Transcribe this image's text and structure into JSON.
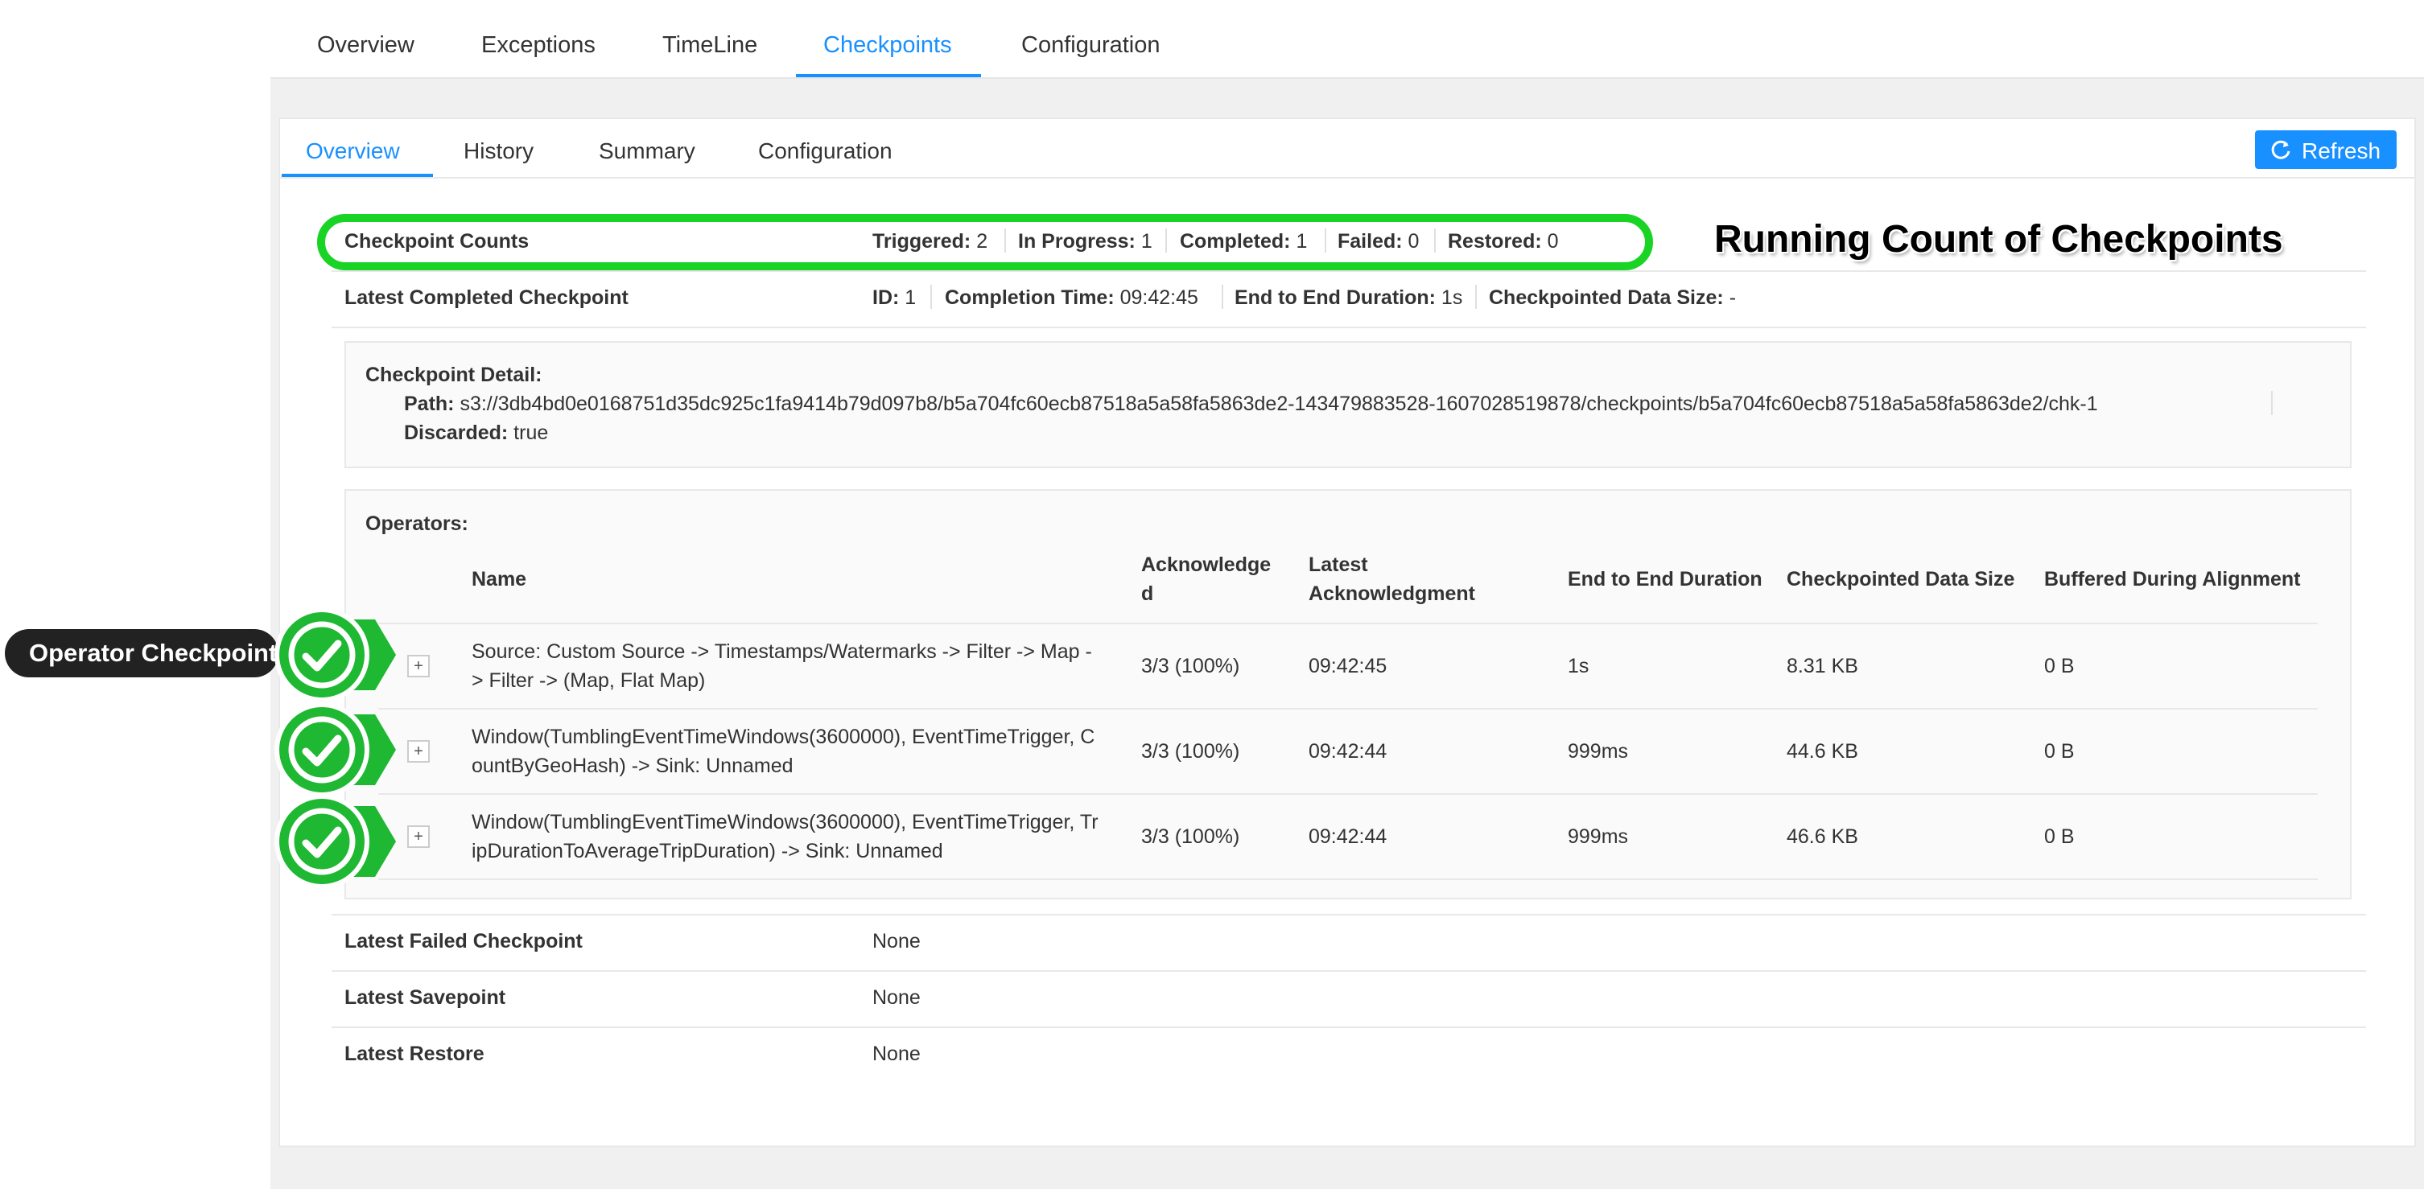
{
  "top_tabs": {
    "overview": "Overview",
    "exceptions": "Exceptions",
    "timeline": "TimeLine",
    "checkpoints": "Checkpoints",
    "configuration": "Configuration",
    "active": "Checkpoints"
  },
  "sub_tabs": {
    "overview": "Overview",
    "history": "History",
    "summary": "Summary",
    "configuration": "Configuration",
    "active": "Overview"
  },
  "refresh": {
    "label": "Refresh",
    "icon": "sync-icon"
  },
  "checkpoint_counts": {
    "label": "Checkpoint Counts",
    "triggered_label": "Triggered:",
    "triggered": "2",
    "in_progress_label": "In Progress:",
    "in_progress": "1",
    "completed_label": "Completed:",
    "completed": "1",
    "failed_label": "Failed:",
    "failed": "0",
    "restored_label": "Restored:",
    "restored": "0"
  },
  "latest_completed": {
    "label": "Latest Completed Checkpoint",
    "id_label": "ID:",
    "id": "1",
    "completion_time_label": "Completion Time:",
    "completion_time": "09:42:45",
    "e2e_label": "End to End Duration:",
    "e2e": "1s",
    "data_size_label": "Checkpointed Data Size:",
    "data_size": "-"
  },
  "detail": {
    "title": "Checkpoint Detail:",
    "path_label": "Path:",
    "path": "s3://3db4bd0e0168751d35dc925c1fa9414b79d097b8/b5a704fc60ecb87518a5a58fa5863de2-143479883528-1607028519878/checkpoints/b5a704fc60ecb87518a5a58fa5863de2/chk-1",
    "discarded_label": "Discarded:",
    "discarded": "true"
  },
  "operators": {
    "title": "Operators:",
    "columns": {
      "name": "Name",
      "ack_1": "Acknowledge",
      "ack_2": "d",
      "latest_ack_1": "Latest",
      "latest_ack_2": "Acknowledgment",
      "e2e": "End to End Duration",
      "size": "Checkpointed Data Size",
      "buffered": "Buffered During Alignment"
    },
    "expand_symbol": "+",
    "rows": [
      {
        "name_1": "Source: Custom Source -> Timestamps/Watermarks -> Filter -> Map -",
        "name_2": "> Filter -> (Map, Flat Map)",
        "ack": "3/3 (100%)",
        "latest": "09:42:45",
        "e2e": "1s",
        "size": "8.31 KB",
        "buffered": "0 B"
      },
      {
        "name_1": "Window(TumblingEventTimeWindows(3600000), EventTimeTrigger, C",
        "name_2": "ountByGeoHash) -> Sink: Unnamed",
        "ack": "3/3 (100%)",
        "latest": "09:42:44",
        "e2e": "999ms",
        "size": "44.6 KB",
        "buffered": "0 B"
      },
      {
        "name_1": "Window(TumblingEventTimeWindows(3600000), EventTimeTrigger, Tr",
        "name_2": "ipDurationToAverageTripDuration) -> Sink: Unnamed",
        "ack": "3/3 (100%)",
        "latest": "09:42:44",
        "e2e": "999ms",
        "size": "46.6 KB",
        "buffered": "0 B"
      }
    ]
  },
  "latest_failed": {
    "label": "Latest Failed Checkpoint",
    "value": "None"
  },
  "latest_savepoint": {
    "label": "Latest Savepoint",
    "value": "None"
  },
  "latest_restore": {
    "label": "Latest Restore",
    "value": "None"
  },
  "annotations": {
    "running_count": "Running Count of Checkpoints",
    "operator_checkpoint": "Operator Checkpoint",
    "highlight_color": "#19d424",
    "badge_icon": "check-icon"
  },
  "colors": {
    "accent": "#1890ff",
    "highlight": "#19d424",
    "badge": "#1fb832"
  }
}
